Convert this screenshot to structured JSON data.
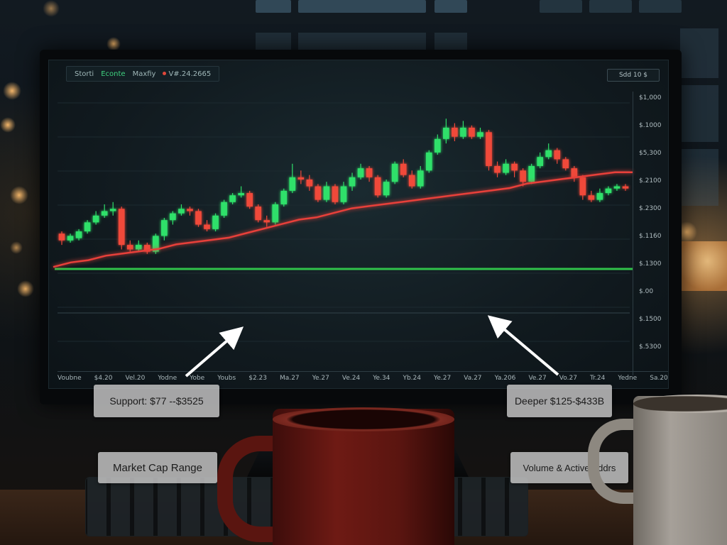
{
  "screen": {
    "tabs": [
      {
        "label": "Storti",
        "accent": "#9fb7b8"
      },
      {
        "label": "Econte",
        "accent": "#3fd27f"
      },
      {
        "label": "Maxfiy",
        "accent": "#9fb7b8"
      },
      {
        "label": "V#.24.2665",
        "accent": "#e0473a"
      }
    ],
    "top_right_label": "Sdd 10  $",
    "y_labels": [
      "$1,000",
      "$.1000",
      "$5,300",
      "$.2100",
      "$.2300",
      "$.1160",
      "$.1300",
      "$.00",
      "$.1500",
      "$.5300"
    ],
    "x_labels": [
      "Voubne",
      "$4.20",
      "Vel.20",
      "Yodne",
      "Yobe",
      "Youbs",
      "$2.23",
      "Ma.27",
      "Ye.27",
      "Ve.24",
      "Ye.34",
      "Yb.24",
      "Ye.27",
      "Va.27",
      "Ya.206",
      "Ve.27",
      "Vo.27",
      "Tr.24",
      "Yedne",
      "Sa.20"
    ]
  },
  "callouts": {
    "support": "Support: $77 --$3525",
    "deeper": "Deeper $125-$433B",
    "market_cap": "Market Cap Range",
    "volume": "Volume & Active Addrs"
  },
  "colors": {
    "bull": "#2fe06a",
    "bear": "#f0493a",
    "ma_line": "#e8403a",
    "support_line": "#30c24a",
    "arrow": "#ffffff"
  },
  "chart_data": {
    "type": "candlestick",
    "candles": [
      {
        "o": 27,
        "c": 24,
        "h": 28,
        "l": 22
      },
      {
        "o": 24,
        "c": 26,
        "h": 27,
        "l": 23
      },
      {
        "o": 25,
        "c": 28,
        "h": 29,
        "l": 24
      },
      {
        "o": 28,
        "c": 32,
        "h": 33,
        "l": 27
      },
      {
        "o": 32,
        "c": 35,
        "h": 37,
        "l": 31
      },
      {
        "o": 35,
        "c": 37,
        "h": 40,
        "l": 34
      },
      {
        "o": 37,
        "c": 38,
        "h": 41,
        "l": 35
      },
      {
        "o": 38,
        "c": 22,
        "h": 39,
        "l": 20
      },
      {
        "o": 22,
        "c": 20,
        "h": 24,
        "l": 19
      },
      {
        "o": 20,
        "c": 22,
        "h": 24,
        "l": 19
      },
      {
        "o": 22,
        "c": 19,
        "h": 23,
        "l": 18
      },
      {
        "o": 19,
        "c": 26,
        "h": 27,
        "l": 18
      },
      {
        "o": 26,
        "c": 33,
        "h": 34,
        "l": 24
      },
      {
        "o": 33,
        "c": 36,
        "h": 37,
        "l": 31
      },
      {
        "o": 36,
        "c": 38,
        "h": 40,
        "l": 35
      },
      {
        "o": 38,
        "c": 37,
        "h": 39,
        "l": 35
      },
      {
        "o": 37,
        "c": 31,
        "h": 38,
        "l": 30
      },
      {
        "o": 31,
        "c": 29,
        "h": 33,
        "l": 28
      },
      {
        "o": 29,
        "c": 35,
        "h": 36,
        "l": 28
      },
      {
        "o": 35,
        "c": 41,
        "h": 42,
        "l": 34
      },
      {
        "o": 41,
        "c": 44,
        "h": 45,
        "l": 40
      },
      {
        "o": 44,
        "c": 45,
        "h": 48,
        "l": 43
      },
      {
        "o": 45,
        "c": 39,
        "h": 46,
        "l": 38
      },
      {
        "o": 39,
        "c": 33,
        "h": 40,
        "l": 32
      },
      {
        "o": 33,
        "c": 32,
        "h": 35,
        "l": 30
      },
      {
        "o": 32,
        "c": 40,
        "h": 41,
        "l": 31
      },
      {
        "o": 40,
        "c": 46,
        "h": 47,
        "l": 39
      },
      {
        "o": 46,
        "c": 52,
        "h": 58,
        "l": 45
      },
      {
        "o": 52,
        "c": 51,
        "h": 55,
        "l": 49
      },
      {
        "o": 51,
        "c": 48,
        "h": 53,
        "l": 46
      },
      {
        "o": 48,
        "c": 42,
        "h": 49,
        "l": 41
      },
      {
        "o": 42,
        "c": 48,
        "h": 50,
        "l": 41
      },
      {
        "o": 48,
        "c": 41,
        "h": 49,
        "l": 40
      },
      {
        "o": 41,
        "c": 48,
        "h": 50,
        "l": 40
      },
      {
        "o": 48,
        "c": 52,
        "h": 54,
        "l": 46
      },
      {
        "o": 52,
        "c": 56,
        "h": 58,
        "l": 51
      },
      {
        "o": 56,
        "c": 52,
        "h": 57,
        "l": 50
      },
      {
        "o": 52,
        "c": 44,
        "h": 53,
        "l": 43
      },
      {
        "o": 44,
        "c": 50,
        "h": 51,
        "l": 43
      },
      {
        "o": 50,
        "c": 58,
        "h": 59,
        "l": 49
      },
      {
        "o": 58,
        "c": 53,
        "h": 60,
        "l": 52
      },
      {
        "o": 53,
        "c": 48,
        "h": 55,
        "l": 47
      },
      {
        "o": 48,
        "c": 55,
        "h": 57,
        "l": 47
      },
      {
        "o": 55,
        "c": 63,
        "h": 64,
        "l": 54
      },
      {
        "o": 63,
        "c": 69,
        "h": 71,
        "l": 62
      },
      {
        "o": 69,
        "c": 74,
        "h": 78,
        "l": 67
      },
      {
        "o": 74,
        "c": 70,
        "h": 76,
        "l": 68
      },
      {
        "o": 70,
        "c": 74,
        "h": 77,
        "l": 69
      },
      {
        "o": 74,
        "c": 70,
        "h": 75,
        "l": 69
      },
      {
        "o": 70,
        "c": 72,
        "h": 74,
        "l": 69
      },
      {
        "o": 72,
        "c": 57,
        "h": 73,
        "l": 55
      },
      {
        "o": 57,
        "c": 54,
        "h": 59,
        "l": 52
      },
      {
        "o": 54,
        "c": 58,
        "h": 60,
        "l": 53
      },
      {
        "o": 58,
        "c": 55,
        "h": 59,
        "l": 52
      },
      {
        "o": 55,
        "c": 50,
        "h": 56,
        "l": 48
      },
      {
        "o": 50,
        "c": 57,
        "h": 58,
        "l": 49
      },
      {
        "o": 57,
        "c": 61,
        "h": 63,
        "l": 56
      },
      {
        "o": 61,
        "c": 64,
        "h": 67,
        "l": 60
      },
      {
        "o": 64,
        "c": 60,
        "h": 65,
        "l": 58
      },
      {
        "o": 60,
        "c": 56,
        "h": 61,
        "l": 55
      },
      {
        "o": 56,
        "c": 52,
        "h": 57,
        "l": 50
      },
      {
        "o": 52,
        "c": 44,
        "h": 53,
        "l": 42
      },
      {
        "o": 44,
        "c": 42,
        "h": 46,
        "l": 41
      },
      {
        "o": 42,
        "c": 45,
        "h": 47,
        "l": 41
      },
      {
        "o": 45,
        "c": 47,
        "h": 48,
        "l": 44
      },
      {
        "o": 47,
        "c": 48,
        "h": 49,
        "l": 46
      },
      {
        "o": 48,
        "c": 47,
        "h": 49,
        "l": 46
      }
    ],
    "moving_average": [
      16,
      18,
      19,
      21,
      22,
      23,
      24,
      26,
      27,
      28,
      29,
      31,
      33,
      35,
      37,
      38,
      40,
      42,
      43,
      44,
      45,
      46,
      47,
      48,
      49,
      50,
      51,
      53,
      54,
      55,
      56,
      57,
      58,
      58
    ],
    "support_level": 17,
    "ylim": [
      0,
      85
    ]
  }
}
